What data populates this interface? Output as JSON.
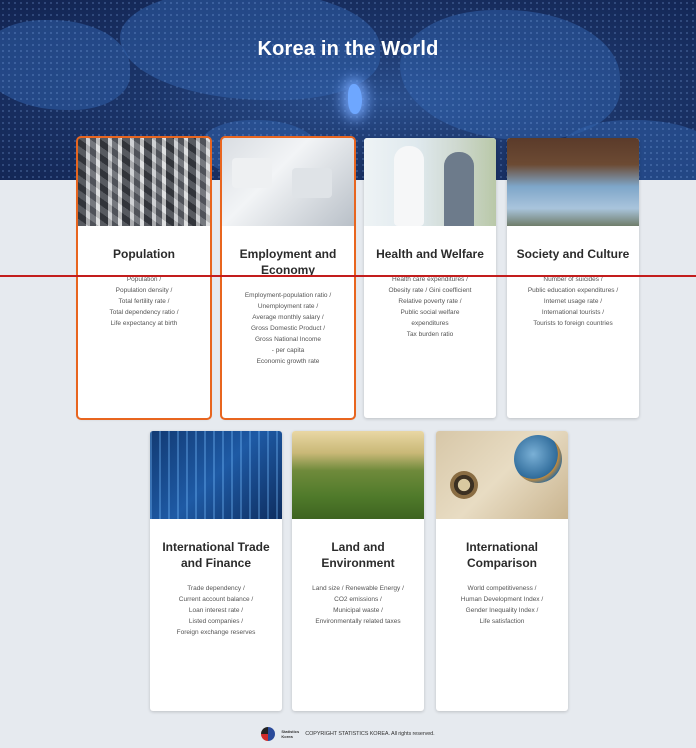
{
  "page": {
    "title": "Korea in the World"
  },
  "cards": [
    {
      "title": "Population",
      "items": [
        "Population /",
        "Population density /",
        "Total fertility rate /",
        "Total dependency ratio /",
        "Life expectancy at birth"
      ]
    },
    {
      "title": "Employment and Economy",
      "items": [
        "Employment-population ratio /",
        "Unemployment rate /",
        "Average monthly salary /",
        "Gross Domestic Product /",
        "Gross National Income",
        "- per capita",
        "Economic growth rate"
      ]
    },
    {
      "title": "Health and Welfare",
      "items": [
        "Health care expenditures /",
        "Obesity rate / Gini coefficient",
        "Relative poverty rate /",
        "Public social welfare",
        "expenditures",
        "Tax burden ratio"
      ]
    },
    {
      "title": "Society and Culture",
      "items": [
        "Number of suicides /",
        "Public education expenditures /",
        "Internet usage rate /",
        "International tourists /",
        "Tourists to foreign countries"
      ]
    },
    {
      "title": "International Trade and Finance",
      "items": [
        "Trade dependency /",
        "Current account balance /",
        "Loan interest rate /",
        "Listed companies /",
        "Foreign exchange reserves"
      ]
    },
    {
      "title": "Land and Environment",
      "items": [
        "Land size / Renewable Energy /",
        "CO2 emissions /",
        "Municipal waste /",
        "Environmentally related taxes"
      ]
    },
    {
      "title": "International Comparison",
      "items": [
        "World competitiveness /",
        "Human Development Index /",
        "Gender Inequality Index /",
        "Life satisfaction"
      ]
    }
  ],
  "footer": {
    "logo_line1": "Statistics",
    "logo_line2": "Korea",
    "copyright": "COPYRIGHT STATISTICS KOREA. All rights reserved."
  },
  "colors": {
    "selected_outline": "#e8651f",
    "banner": "#1b3468",
    "divider_line": "#c31d1d"
  }
}
